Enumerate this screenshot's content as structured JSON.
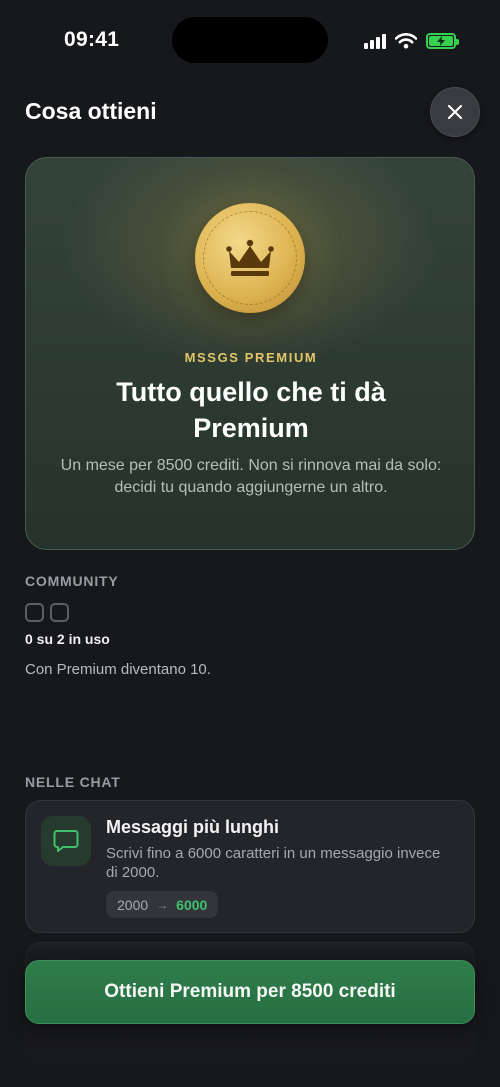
{
  "status_bar": {
    "time": "09:41"
  },
  "header": {
    "title": "Cosa ottieni",
    "close_label": "Chiudi"
  },
  "hero": {
    "eyebrow": "MSSGS PREMIUM",
    "title": "Tutto quello che ti dà Premium",
    "description": "Un mese per 8500 crediti. Non si rinnova mai da solo: decidi tu quando aggiungerne un altro."
  },
  "community": {
    "label": "COMMUNITY",
    "slots_used": 0,
    "slots_total": 2,
    "usage_text": "0 su 2 in uso",
    "note": "Con Premium diventano 10."
  },
  "chat_section": {
    "label": "NELLE CHAT",
    "features": [
      {
        "title": "Messaggi più lunghi",
        "description": "Scrivi fino a 6000 caratteri in un messaggio invece di 2000.",
        "old_value": "2000",
        "new_value": "6000",
        "icon": "chat-bubble-icon"
      }
    ]
  },
  "cta": {
    "label": "Ottieni Premium per 8500 crediti"
  },
  "colors": {
    "accent_green": "#3fc06a",
    "cta_green": "#2f7d4b",
    "gold": "#e4c56a",
    "background": "#17181b"
  }
}
